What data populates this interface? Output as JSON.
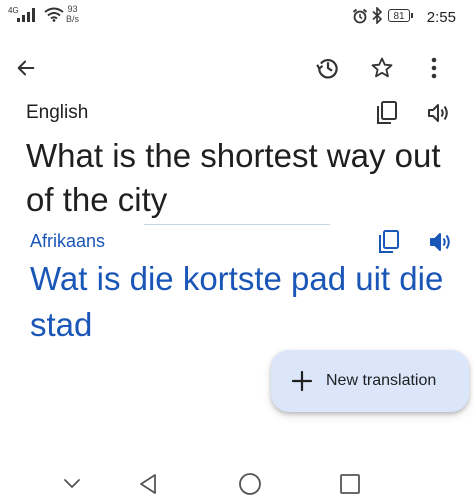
{
  "status_bar": {
    "signal_label": "4G",
    "net_speed_value": "93",
    "net_speed_unit": "B/s",
    "battery_level": "81",
    "time": "2:55"
  },
  "toolbar": {
    "back_icon": "arrow-left-icon",
    "history_icon": "history-icon",
    "star_icon": "star-outline-icon",
    "more_icon": "more-vert-icon"
  },
  "source": {
    "language": "English",
    "text": "What is the shortest way out of the city"
  },
  "target": {
    "language": "Afrikaans",
    "text": "Wat is die kortste pad uit die stad"
  },
  "fab": {
    "label": "New translation",
    "icon": "plus-icon"
  },
  "colors": {
    "accent": "#1a56b8",
    "fab_background": "#dbe6fb",
    "text": "#1f1f1f"
  }
}
